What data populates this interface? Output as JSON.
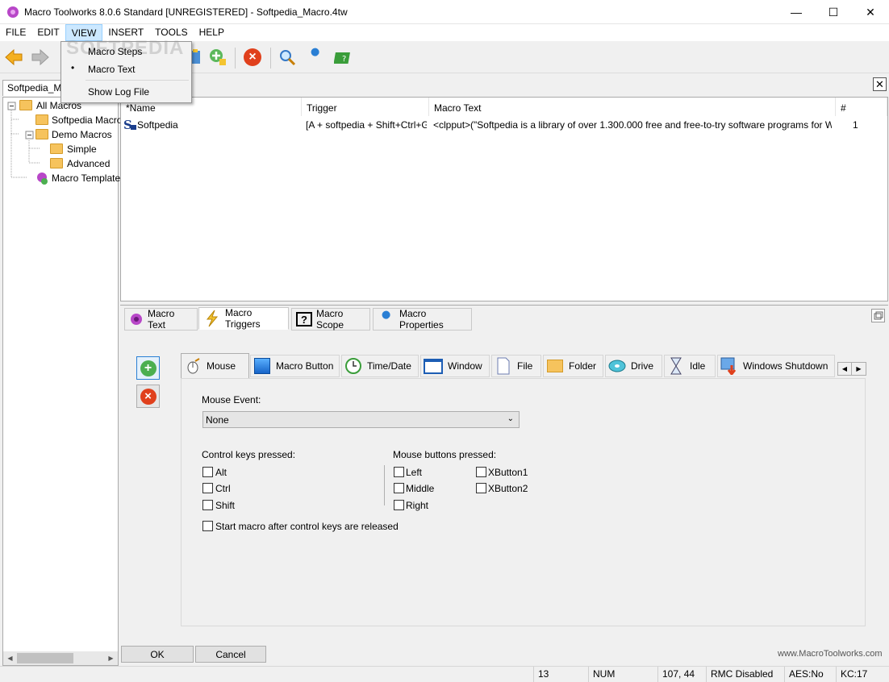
{
  "window": {
    "title": "Macro Toolworks 8.0.6 Standard [UNREGISTERED] - Softpedia_Macro.4tw",
    "minimize": "—",
    "maximize": "☐",
    "close": "✕"
  },
  "menu": [
    "FILE",
    "EDIT",
    "VIEW",
    "INSERT",
    "TOOLS",
    "HELP"
  ],
  "view_menu": {
    "items": [
      "Macro Steps",
      "Macro Text",
      "Show Log File"
    ],
    "checked_bullet": "•"
  },
  "watermark": "SOFTPEDIA",
  "file_tab": "Softpedia_Macro.4tw",
  "pane_close": "✕",
  "tree": {
    "root": "All Macros",
    "items": [
      "Softpedia Macros",
      "Demo Macros",
      "Simple",
      "Advanced",
      "Macro Templates"
    ]
  },
  "list": {
    "columns": [
      "*Name",
      "Trigger",
      "Macro Text",
      "#"
    ],
    "rows": [
      {
        "name": "Softpedia",
        "trigger": "[A + softpedia + Shift+Ctrl+G ...",
        "macro_text": "<clpput>(\"Softpedia is a library of over 1.300.000 free and free-to-try software programs for Windows a...",
        "count": "1"
      }
    ]
  },
  "panel_tabs": [
    "Macro Text",
    "Macro Triggers",
    "Macro Scope",
    "Macro Properties"
  ],
  "trigger_tabs": [
    "Mouse",
    "Macro Button",
    "Time/Date",
    "Window",
    "File",
    "Folder",
    "Drive",
    "Idle",
    "Windows Shutdown"
  ],
  "mouse_form": {
    "mouse_event_label": "Mouse Event:",
    "mouse_event_value": "None",
    "control_keys_label": "Control keys pressed:",
    "control_keys": [
      "Alt",
      "Ctrl",
      "Shift"
    ],
    "mouse_buttons_label": "Mouse buttons pressed:",
    "mouse_buttons_left": [
      "Left",
      "Middle",
      "Right"
    ],
    "mouse_buttons_right": [
      "XButton1",
      "XButton2"
    ],
    "start_after_release": "Start macro after control keys are released"
  },
  "buttons": {
    "ok": "OK",
    "cancel": "Cancel"
  },
  "website": "www.MacroToolworks.com",
  "status": {
    "count": "13",
    "num": "NUM",
    "coords": "107, 44",
    "rmc": "RMC Disabled",
    "aes": "AES:No",
    "kc": "KC:17"
  },
  "colors": {
    "accent_selection": "#cce8ff",
    "add_green": "#4caf50",
    "delete_red": "#e0401c"
  }
}
